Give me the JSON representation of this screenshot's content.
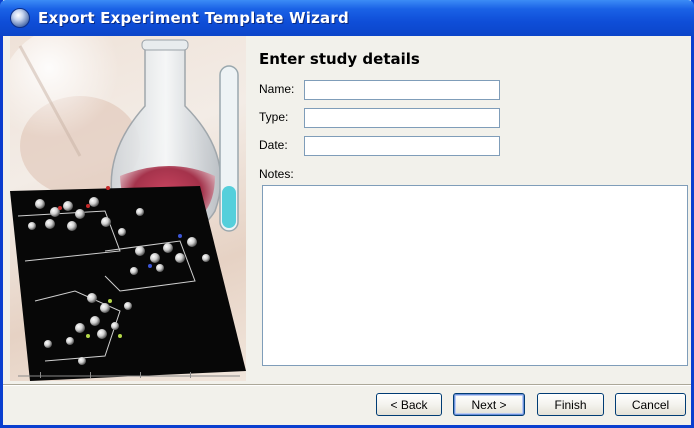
{
  "window": {
    "title": "Export Experiment Template Wizard",
    "icon": "app-globe-icon"
  },
  "illustration": {
    "subject": "lab-glassware-and-molecule-clusters"
  },
  "form": {
    "heading": "Enter study details",
    "name": {
      "label": "Name:",
      "value": ""
    },
    "type": {
      "label": "Type:",
      "value": ""
    },
    "date": {
      "label": "Date:",
      "value": ""
    },
    "notes": {
      "label": "Notes:",
      "value": ""
    }
  },
  "buttons": {
    "back": "< Back",
    "next": "Next >",
    "finish": "Finish",
    "cancel": "Cancel"
  },
  "colors": {
    "titlebar": "#0F4ED8",
    "frame": "#0A3FCF",
    "dialog_bg": "#F2F1EB",
    "field_border": "#7F9DB9"
  }
}
